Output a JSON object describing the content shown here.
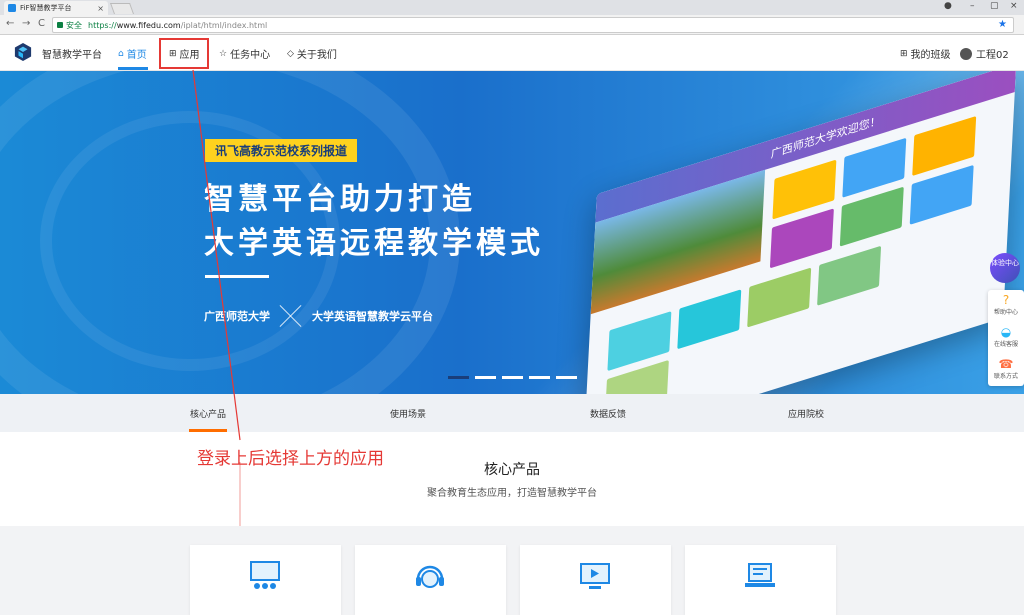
{
  "browser": {
    "tab_title": "FiF智慧教学平台",
    "tab_close": "×",
    "secure_label": "安全",
    "url_scheme": "https://",
    "url_host": "www.fifedu.com",
    "url_path": "/iplat/html/index.html",
    "nav_back": "←",
    "nav_forward": "→",
    "nav_reload": "C",
    "win_account": "●",
    "win_minimize": "–",
    "win_restore": "▢",
    "win_close": "×",
    "menu": "⋮",
    "bookmark": "★"
  },
  "header": {
    "brand": "智慧教学平台",
    "nav": [
      {
        "label": "首页",
        "icon": "⌂"
      },
      {
        "label": "应用",
        "icon": "⊞"
      },
      {
        "label": "任务中心",
        "icon": "☆"
      },
      {
        "label": "关于我们",
        "icon": "◇"
      }
    ],
    "my_class": "我的班级",
    "my_class_icon": "⊞",
    "user": "工程02"
  },
  "banner": {
    "tag": "讯飞高教示范校系列报道",
    "headline1": "智慧平台助力打造",
    "headline2": "大学英语远程教学模式",
    "sub_left": "广西师范大学",
    "sub_right": "大学英语智慧教学云平台",
    "mock_welcome": "广西师范大学欢迎您！",
    "dots": 5,
    "active_dot": 0
  },
  "float": {
    "experience": "体验中心",
    "tools": [
      {
        "label": "帮助中心",
        "icon": "?"
      },
      {
        "label": "在线客服",
        "icon": "◒"
      },
      {
        "label": "联系方式",
        "icon": "☎"
      }
    ]
  },
  "section_tabs": [
    "核心产品",
    "使用场景",
    "数据反馈",
    "应用院校"
  ],
  "annotation": "登录上后选择上方的应用",
  "core": {
    "title": "核心产品",
    "subtitle": "聚合教育生态应用，打造智慧教学平台"
  },
  "colors": {
    "accent": "#1e88e5",
    "annotation": "#e53935",
    "tab_underline": "#ff6d00",
    "tag_bg": "#ffd21e"
  }
}
